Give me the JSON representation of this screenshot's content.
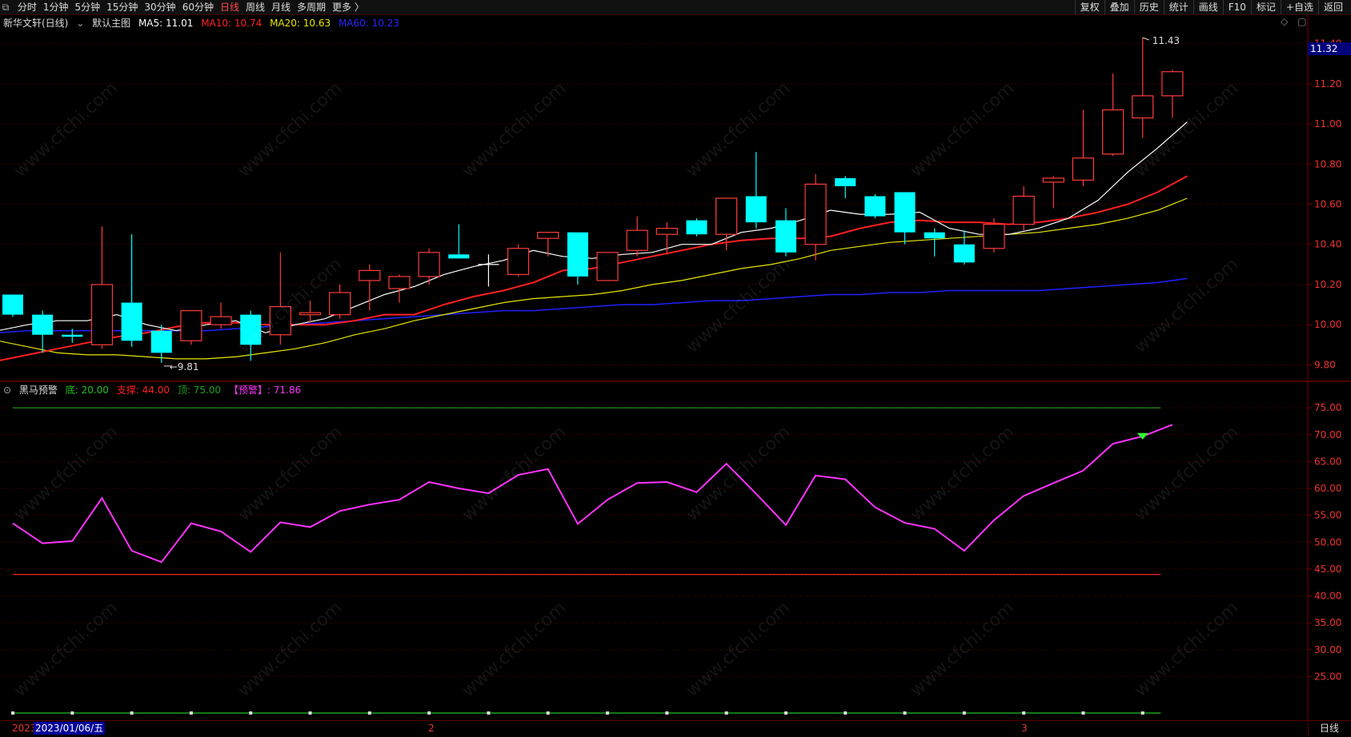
{
  "toolbar": {
    "left_items": [
      "分时",
      "1分钟",
      "5分钟",
      "15分钟",
      "30分钟",
      "60分钟",
      "日线",
      "周线",
      "月线",
      "多周期",
      "更多 〉"
    ],
    "active": "日线",
    "right_items": [
      "复权",
      "叠加",
      "历史",
      "统计",
      "画线",
      "F10",
      "标记",
      "+自选",
      "返回"
    ]
  },
  "main_legend": {
    "stock": "新华文轩(日线)",
    "template": "默认主图",
    "ma5": "MA5: 11.01",
    "ma10": "MA10: 10.74",
    "ma20": "MA20: 10.63",
    "ma60": "MA60: 10.23"
  },
  "indicator_legend": {
    "name": "黑马预警",
    "bottom": "底: 20.00",
    "support": "支撑: 44.00",
    "top": "顶: 75.00",
    "alert": "【预警】: 71.86"
  },
  "price_tag": "11.32",
  "high_label": "11.43",
  "low_label": "9.81",
  "bottom": {
    "year": "2023",
    "cursor_date": "2023/01/06/五",
    "month2": "2",
    "month3": "3",
    "period": "日线"
  },
  "watermark": "www.cfchi.com",
  "colors": {
    "up": "#ff3b3b",
    "down": "#00ffff",
    "ma5": "#ffffff",
    "ma10": "#ff2020",
    "ma20": "#e6e600",
    "ma60": "#2020ff",
    "indicator": "#ff33ff"
  },
  "chart_data": [
    {
      "type": "candlestick",
      "ylim": [
        9.75,
        11.45
      ],
      "y_ticks": [
        11.4,
        11.2,
        11.0,
        10.8,
        10.6,
        10.4,
        10.2,
        10.0,
        9.8
      ],
      "candles": [
        {
          "o": 10.15,
          "h": 10.15,
          "l": 10.04,
          "c": 10.05
        },
        {
          "o": 10.05,
          "h": 10.07,
          "l": 9.86,
          "c": 9.95
        },
        {
          "o": 9.95,
          "h": 9.98,
          "l": 9.91,
          "c": 9.94
        },
        {
          "o": 9.9,
          "h": 10.49,
          "l": 9.88,
          "c": 10.2
        },
        {
          "o": 10.11,
          "h": 10.45,
          "l": 9.89,
          "c": 9.92
        },
        {
          "o": 9.97,
          "h": 10.0,
          "l": 9.81,
          "c": 9.86
        },
        {
          "o": 9.92,
          "h": 10.07,
          "l": 9.9,
          "c": 10.07
        },
        {
          "o": 10.0,
          "h": 10.11,
          "l": 9.98,
          "c": 10.04
        },
        {
          "o": 10.05,
          "h": 10.07,
          "l": 9.82,
          "c": 9.9
        },
        {
          "o": 9.95,
          "h": 10.36,
          "l": 9.9,
          "c": 10.09
        },
        {
          "o": 10.05,
          "h": 10.12,
          "l": 10.01,
          "c": 10.06
        },
        {
          "o": 10.05,
          "h": 10.2,
          "l": 10.03,
          "c": 10.16
        },
        {
          "o": 10.22,
          "h": 10.3,
          "l": 10.07,
          "c": 10.27
        },
        {
          "o": 10.18,
          "h": 10.25,
          "l": 10.11,
          "c": 10.24
        },
        {
          "o": 10.24,
          "h": 10.38,
          "l": 10.2,
          "c": 10.36
        },
        {
          "o": 10.35,
          "h": 10.5,
          "l": 10.33,
          "c": 10.33
        },
        {
          "o": 10.3,
          "h": 10.35,
          "l": 10.19,
          "c": 10.3
        },
        {
          "o": 10.25,
          "h": 10.4,
          "l": 10.24,
          "c": 10.38
        },
        {
          "o": 10.43,
          "h": 10.45,
          "l": 10.34,
          "c": 10.46
        },
        {
          "o": 10.46,
          "h": 10.46,
          "l": 10.2,
          "c": 10.24
        },
        {
          "o": 10.22,
          "h": 10.36,
          "l": 10.22,
          "c": 10.36
        },
        {
          "o": 10.37,
          "h": 10.54,
          "l": 10.34,
          "c": 10.47
        },
        {
          "o": 10.45,
          "h": 10.51,
          "l": 10.35,
          "c": 10.48
        },
        {
          "o": 10.52,
          "h": 10.53,
          "l": 10.44,
          "c": 10.45
        },
        {
          "o": 10.45,
          "h": 10.63,
          "l": 10.37,
          "c": 10.63
        },
        {
          "o": 10.64,
          "h": 10.86,
          "l": 10.48,
          "c": 10.51
        },
        {
          "o": 10.52,
          "h": 10.58,
          "l": 10.34,
          "c": 10.36
        },
        {
          "o": 10.4,
          "h": 10.75,
          "l": 10.32,
          "c": 10.7
        },
        {
          "o": 10.73,
          "h": 10.74,
          "l": 10.63,
          "c": 10.69
        },
        {
          "o": 10.64,
          "h": 10.65,
          "l": 10.53,
          "c": 10.54
        },
        {
          "o": 10.66,
          "h": 10.66,
          "l": 10.4,
          "c": 10.46
        },
        {
          "o": 10.46,
          "h": 10.48,
          "l": 10.34,
          "c": 10.43
        },
        {
          "o": 10.4,
          "h": 10.47,
          "l": 10.3,
          "c": 10.31
        },
        {
          "o": 10.38,
          "h": 10.53,
          "l": 10.36,
          "c": 10.5
        },
        {
          "o": 10.5,
          "h": 10.69,
          "l": 10.47,
          "c": 10.64
        },
        {
          "o": 10.71,
          "h": 10.74,
          "l": 10.58,
          "c": 10.73
        },
        {
          "o": 10.72,
          "h": 11.07,
          "l": 10.69,
          "c": 10.83
        },
        {
          "o": 10.85,
          "h": 11.25,
          "l": 10.84,
          "c": 11.07
        },
        {
          "o": 11.03,
          "h": 11.43,
          "l": 10.93,
          "c": 11.14
        },
        {
          "o": 11.14,
          "h": 11.27,
          "l": 11.03,
          "c": 11.26
        }
      ],
      "ma5": [
        9.97,
        10.0,
        10.02,
        10.02,
        10.05,
        10.0,
        9.97,
        10.0,
        10.02,
        9.96,
        10.0,
        10.03,
        10.09,
        10.15,
        10.19,
        10.25,
        10.29,
        10.32,
        10.37,
        10.34,
        10.33,
        10.35,
        10.36,
        10.4,
        10.4,
        10.46,
        10.48,
        10.52,
        10.57,
        10.55,
        10.55,
        10.56,
        10.48,
        10.45,
        10.45,
        10.48,
        10.53,
        10.62,
        10.76,
        10.88,
        11.01
      ],
      "ma10": [
        9.82,
        9.85,
        9.88,
        9.91,
        9.94,
        9.96,
        9.99,
        10.01,
        10.01,
        10.0,
        10.0,
        10.0,
        10.02,
        10.05,
        10.05,
        10.1,
        10.14,
        10.17,
        10.21,
        10.27,
        10.28,
        10.31,
        10.34,
        10.37,
        10.4,
        10.42,
        10.43,
        10.43,
        10.44,
        10.48,
        10.51,
        10.52,
        10.51,
        10.51,
        10.5,
        10.51,
        10.53,
        10.56,
        10.6,
        10.66,
        10.74
      ],
      "ma20": [
        9.92,
        9.89,
        9.86,
        9.85,
        9.85,
        9.84,
        9.83,
        9.83,
        9.84,
        9.86,
        9.88,
        9.91,
        9.95,
        9.98,
        10.02,
        10.05,
        10.08,
        10.11,
        10.13,
        10.14,
        10.15,
        10.17,
        10.2,
        10.22,
        10.25,
        10.28,
        10.3,
        10.33,
        10.37,
        10.39,
        10.41,
        10.42,
        10.43,
        10.44,
        10.45,
        10.46,
        10.48,
        10.5,
        10.53,
        10.57,
        10.63
      ],
      "ma60": [
        9.96,
        9.97,
        9.97,
        9.97,
        9.97,
        9.97,
        9.97,
        9.97,
        9.98,
        9.99,
        10.0,
        10.01,
        10.02,
        10.03,
        10.04,
        10.05,
        10.06,
        10.07,
        10.07,
        10.08,
        10.09,
        10.1,
        10.1,
        10.11,
        10.12,
        10.12,
        10.13,
        10.14,
        10.15,
        10.15,
        10.16,
        10.16,
        10.17,
        10.17,
        10.17,
        10.17,
        10.18,
        10.19,
        10.2,
        10.21,
        10.23
      ]
    },
    {
      "type": "line",
      "name": "黑马预警",
      "ylim": [
        20,
        78
      ],
      "y_ticks": [
        75.0,
        70.0,
        65.0,
        60.0,
        55.0,
        50.0,
        45.0,
        40.0,
        35.0,
        30.0,
        25.0
      ],
      "values": [
        53.5,
        49.8,
        50.2,
        58.2,
        48.4,
        46.3,
        53.5,
        52.0,
        48.2,
        53.7,
        52.8,
        55.8,
        57.0,
        57.9,
        61.2,
        60.0,
        59.1,
        62.5,
        63.6,
        53.4,
        57.9,
        61.0,
        61.2,
        59.3,
        64.6,
        59.0,
        53.2,
        62.4,
        61.7,
        56.5,
        53.6,
        52.5,
        48.4,
        54.1,
        58.6,
        61.0,
        63.3,
        68.3,
        69.7,
        71.86
      ],
      "bottom_line": 20.0,
      "support_line": 44.0,
      "top_line": 75.0
    }
  ]
}
